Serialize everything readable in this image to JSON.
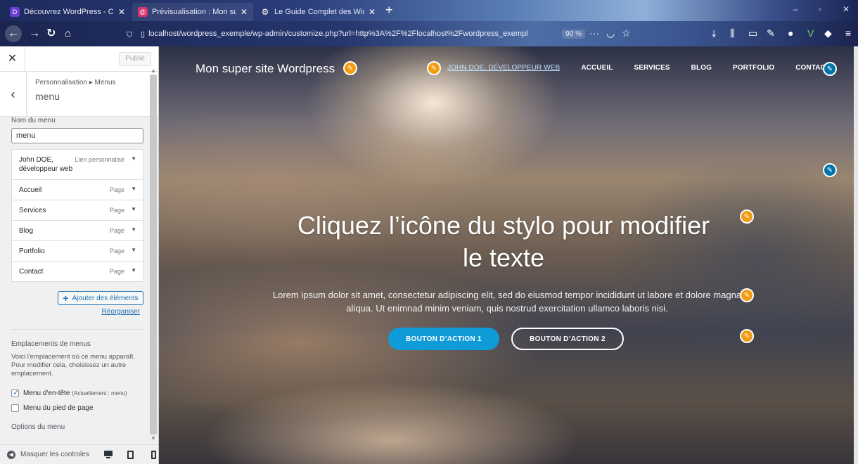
{
  "browser": {
    "tabs": [
      {
        "title": "Découvrez WordPress - Créez un",
        "favicon": "D",
        "active": false
      },
      {
        "title": "Prévisualisation : Mon super site",
        "favicon": "@",
        "active": true
      },
      {
        "title": "Le Guide Complet des Widgets",
        "favicon": "⚙",
        "active": false
      }
    ],
    "url": "localhost/wordpress_exemple/wp-admin/customize.php?url=http%3A%2F%2Flocalhost%2Fwordpress_exempl",
    "zoom": "90 %",
    "menu_more": "···"
  },
  "sidebar": {
    "publish_label": "Publié",
    "breadcrumb": "Personnalisation ▸ Menus",
    "section_title": "menu",
    "menu_name_label": "Nom du menu",
    "menu_name_value": "menu",
    "items": [
      {
        "title": "John DOE, développeur web",
        "type": "Lien personnalisé"
      },
      {
        "title": "Accueil",
        "type": "Page"
      },
      {
        "title": "Services",
        "type": "Page"
      },
      {
        "title": "Blog",
        "type": "Page"
      },
      {
        "title": "Portfolio",
        "type": "Page"
      },
      {
        "title": "Contact",
        "type": "Page"
      }
    ],
    "add_items_label": "Ajouter des éléments",
    "reorder_label": "Réorganiser",
    "locations_heading": "Emplacements de menus",
    "locations_desc": "Voici l'emplacement où ce menu apparaît. Pour modifier cela, choisissez un autre emplacement.",
    "locations": [
      {
        "label": "Menu d'en-tête",
        "note": "(Actuellement : menu)",
        "checked": true
      },
      {
        "label": "Menu du pied de page",
        "note": "",
        "checked": false
      }
    ],
    "options_heading": "Options du menu",
    "hide_controls_label": "Masquer les controles"
  },
  "preview": {
    "site_title": "Mon super site Wordpress",
    "nav": [
      "JOHN DOE, DÉVELOPPEUR WEB",
      "ACCUEIL",
      "SERVICES",
      "BLOG",
      "PORTFOLIO",
      "CONTACT"
    ],
    "hero_title": "Cliquez l’icône du stylo pour modifier le texte",
    "hero_text": "Lorem ipsum dolor sit amet, consectetur adipiscing elit, sed do eiusmod tempor incididunt ut labore et dolore magna aliqua. Ut enimnad minim veniam, quis nostrud exercitation ullamco laboris nisi.",
    "button1": "BOUTON D’ACTION 1",
    "button2": "BOUTON D’ACTION 2"
  },
  "colors": {
    "accent_blue": "#2271b1",
    "pencil_orange": "#f39c12",
    "pencil_blue": "#0073aa",
    "cta_blue": "#0f9ad8"
  }
}
